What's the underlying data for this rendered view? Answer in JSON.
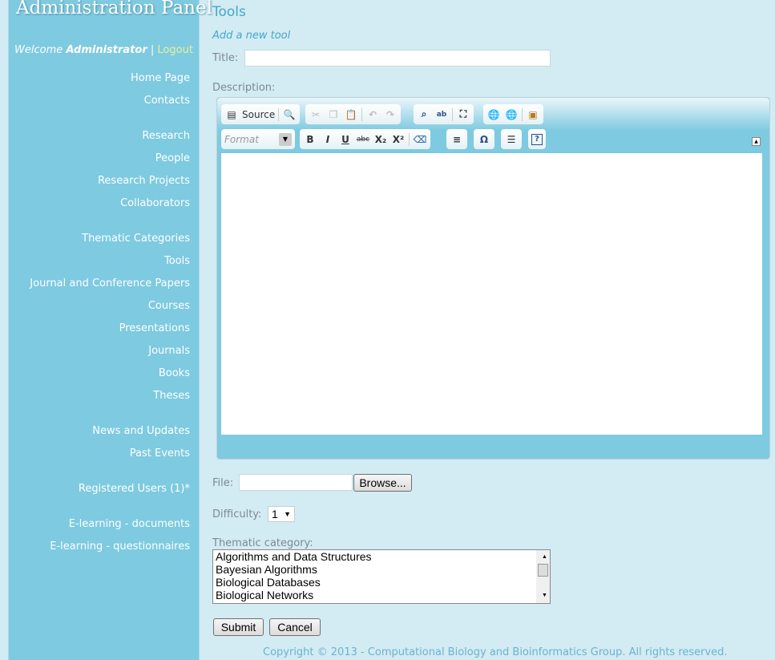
{
  "sidebar": {
    "brand": "Administration Panel",
    "welcome": "Welcome",
    "user": "Administrator",
    "sep": "|",
    "logout": "Logout",
    "items": [
      "Home Page",
      "Contacts",
      "Research",
      "People",
      "Research Projects",
      "Collaborators",
      "Thematic Categories",
      "Tools",
      "Journal and Conference Papers",
      "Courses",
      "Presentations",
      "Journals",
      "Books",
      "Theses",
      "News and Updates",
      "Past Events",
      "Registered Users (1)*",
      "E-learning - documents",
      "E-learning - questionnaires"
    ]
  },
  "main": {
    "title": "Tools",
    "subtitle": "Add a new tool",
    "title_label": "Title:",
    "title_value": "",
    "description_label": "Description:",
    "editor": {
      "source": "Source",
      "format": "Format"
    },
    "file_label": "File:",
    "browse": "Browse...",
    "difficulty_label": "Difficulty:",
    "difficulty_value": "1",
    "category_label": "Thematic category:",
    "categories": [
      "Algorithms and Data Structures",
      "Bayesian Algorithms",
      "Biological Databases",
      "Biological Networks"
    ],
    "submit": "Submit",
    "cancel": "Cancel"
  },
  "footer": "Copyright © 2013 - Computational Biology and Bioinformatics Group. All rights reserved."
}
